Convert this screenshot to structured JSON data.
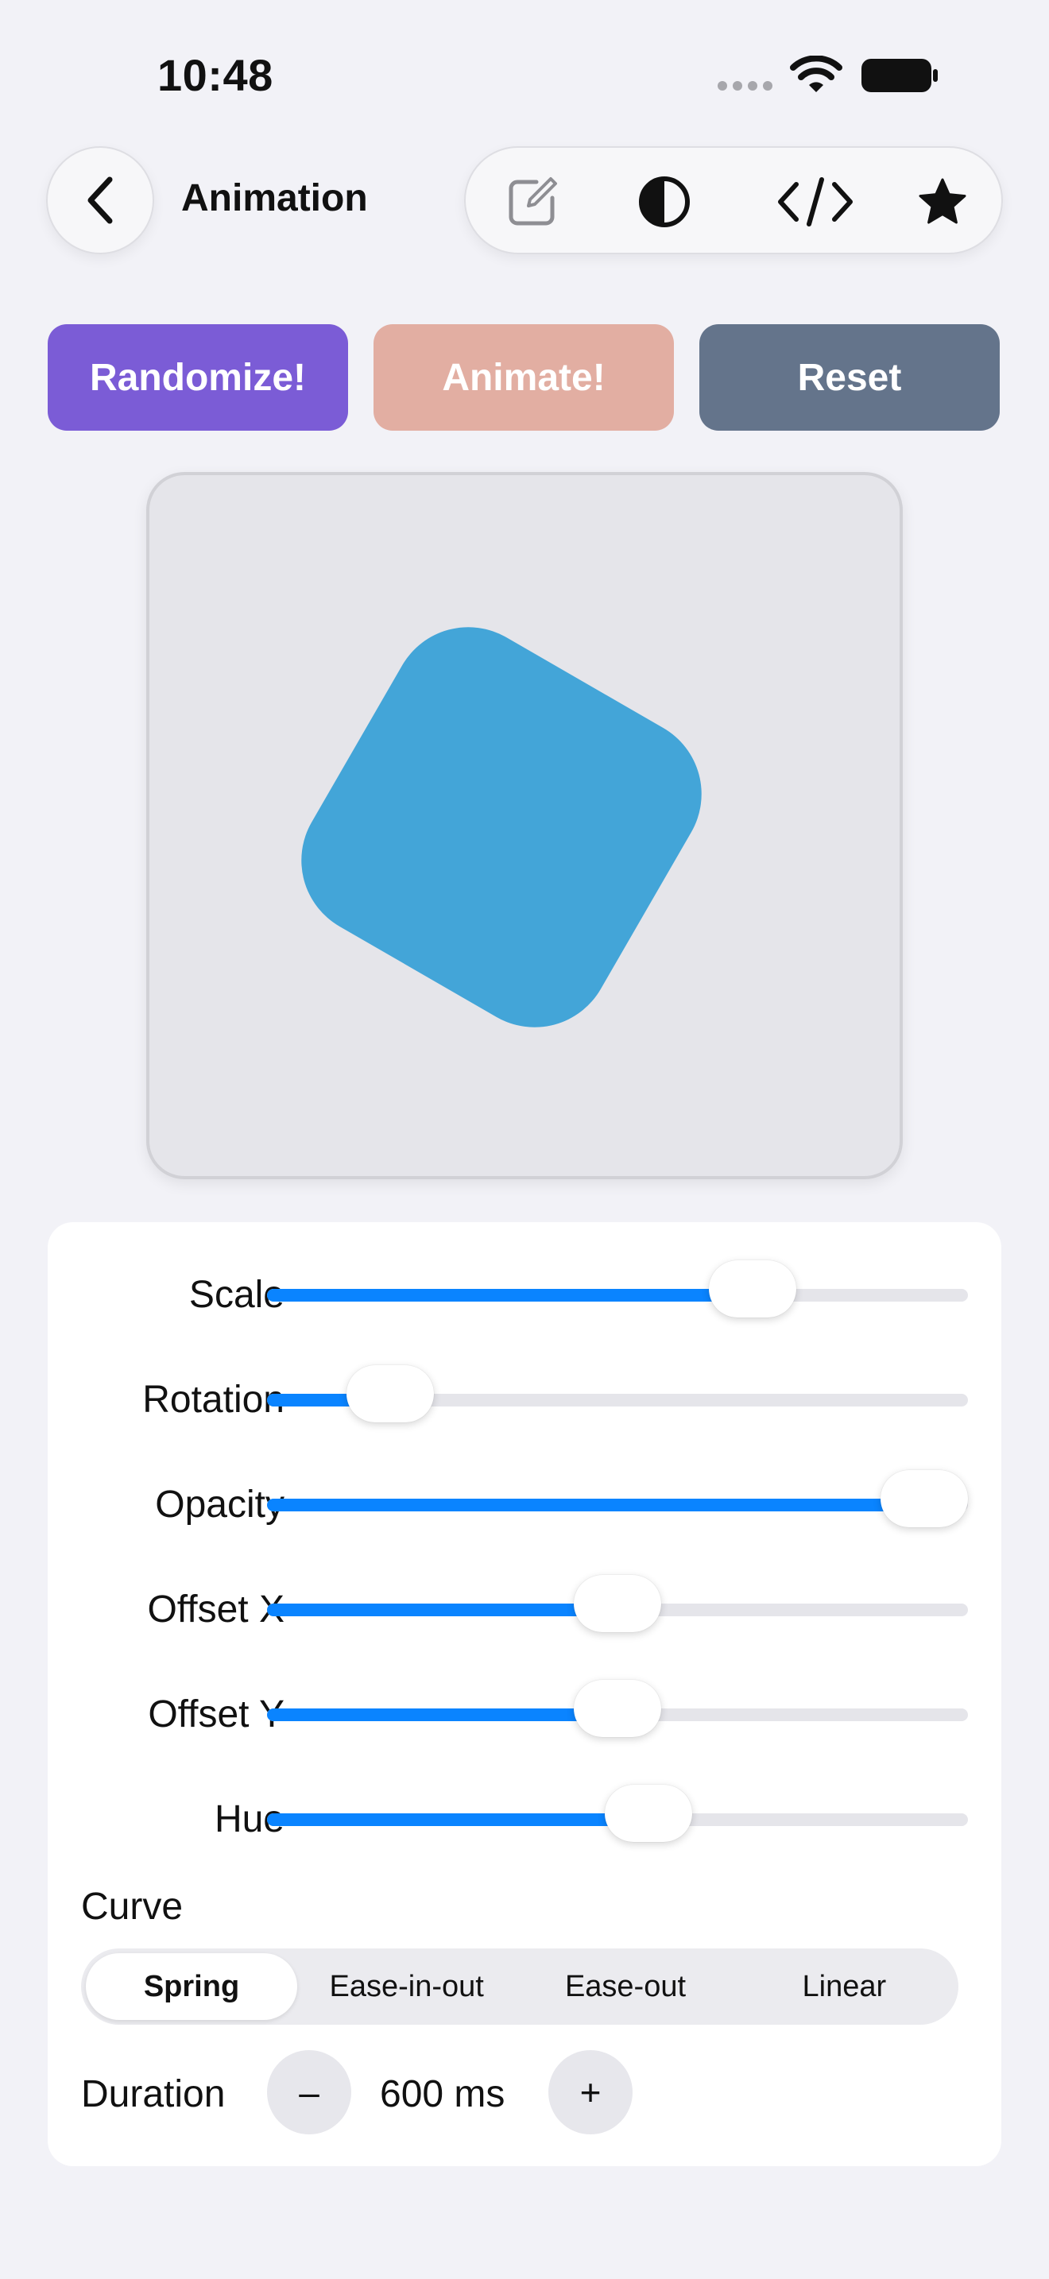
{
  "status": {
    "time": "10:48"
  },
  "nav": {
    "title": "Animation"
  },
  "toolbar": {
    "items": [
      {
        "icon": "edit-icon"
      },
      {
        "icon": "contrast-icon"
      },
      {
        "icon": "code-icon"
      },
      {
        "icon": "star-icon"
      }
    ]
  },
  "actions": {
    "randomize": "Randomize!",
    "animate": "Animate!",
    "reset": "Reset"
  },
  "colors": {
    "randomize": "#7b5cd6",
    "animate": "#e2aea2",
    "reset": "#64748b",
    "accent": "#0a84ff",
    "shape": "#43a5d8"
  },
  "sliders": [
    {
      "label": "Scale",
      "value": 0.72
    },
    {
      "label": "Rotation",
      "value": 0.13
    },
    {
      "label": "Opacity",
      "value": 1.0
    },
    {
      "label": "Offset X",
      "value": 0.5
    },
    {
      "label": "Offset Y",
      "value": 0.5
    },
    {
      "label": "Hue",
      "value": 0.55
    }
  ],
  "curve": {
    "label": "Curve",
    "options": [
      "Spring",
      "Ease-in-out",
      "Ease-out",
      "Linear"
    ],
    "selected": "Spring"
  },
  "duration": {
    "label": "Duration",
    "value": "600 ms",
    "decrement": "–",
    "increment": "+"
  }
}
